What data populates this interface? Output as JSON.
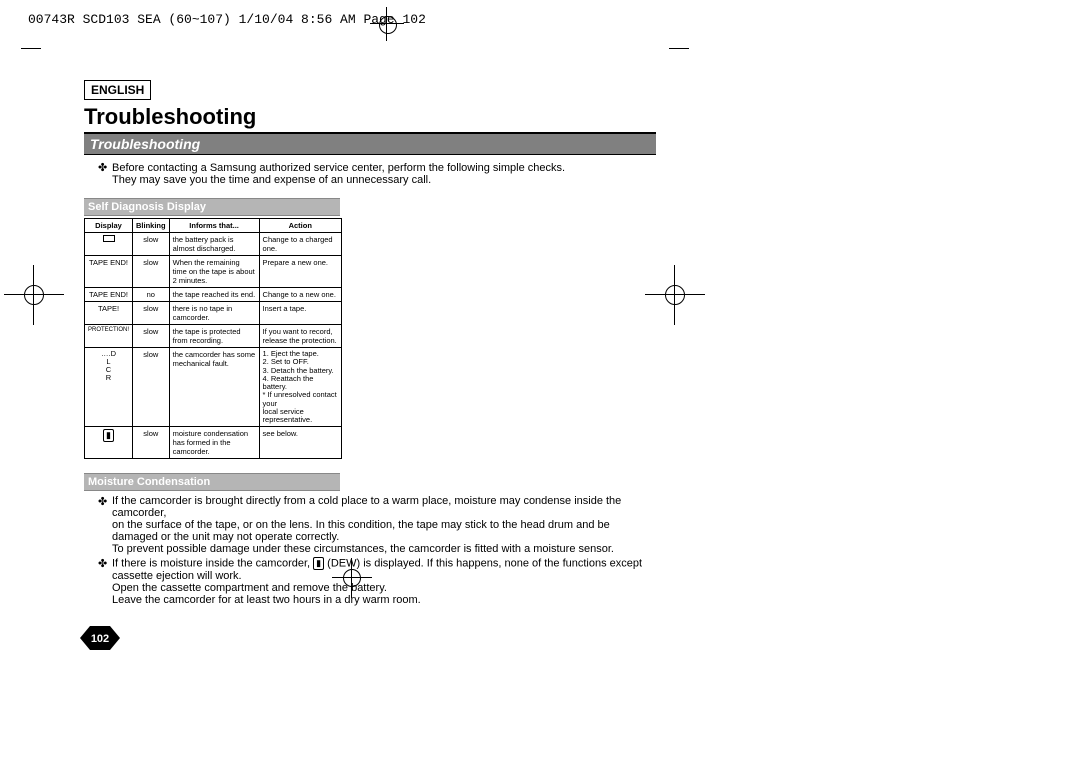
{
  "header": "00743R SCD103 SEA (60~107)  1/10/04 8:56 AM  Page 102",
  "lang": "ENGLISH",
  "title": "Troubleshooting",
  "bar_title": "Troubleshooting",
  "intro_line1": "Before contacting a Samsung authorized service center, perform the following simple checks.",
  "intro_line2": "They may save you the time and expense of an unnecessary call.",
  "selfdiag_head": "Self Diagnosis Display",
  "table_headers": {
    "display": "Display",
    "blinking": "Blinking",
    "informs": "Informs that...",
    "action": "Action"
  },
  "rows": [
    {
      "display": "⎕",
      "blinking": "slow",
      "informs": "the battery pack is almost discharged.",
      "action": "Change to a charged one."
    },
    {
      "display": "TAPE END!",
      "blinking": "slow",
      "informs": "When the remaining time on the tape is about 2 minutes.",
      "action": "Prepare a new one."
    },
    {
      "display": "TAPE END!",
      "blinking": "no",
      "informs": "the tape reached its end.",
      "action": "Change to a new one."
    },
    {
      "display": "TAPE!",
      "blinking": "slow",
      "informs": "there is no tape in camcorder.",
      "action": "Insert a tape."
    },
    {
      "display": "PROTECTION!",
      "blinking": "slow",
      "informs": "the tape is protected from recording.",
      "action": "If you want to record, release the protection."
    },
    {
      "display": "….D\nL\nC\nR",
      "blinking": "slow",
      "informs": "the camcorder has some mechanical fault.",
      "action": "1. Eject the tape.\n2. Set to OFF.\n3. Detach the battery.\n4. Reattach the battery.\n* If unresolved contact your\n   local service representative."
    },
    {
      "display": "DEW",
      "blinking": "slow",
      "informs": "moisture condensation has formed in the camcorder.",
      "action": "see below."
    }
  ],
  "mc_head": "Moisture Condensation",
  "mc": {
    "b1a": "If the camcorder is brought directly from a cold place to a warm place, moisture may condense inside the camcorder,",
    "b1b": "on the surface of the tape, or on the lens. In this condition, the tape may stick to the head drum and be damaged or the unit may not operate correctly.",
    "b1c": "To prevent possible damage under these circumstances, the camcorder is fitted with a moisture sensor.",
    "b2a_pre": "If there is moisture inside the camcorder, ",
    "b2a_post": " (DEW) is displayed. If this happens, none of the functions except cassette ejection will work.",
    "b2b": "Open the cassette compartment and remove the battery.",
    "b2c": "Leave the camcorder for at least two hours in a dry warm room."
  },
  "page_number": "102"
}
